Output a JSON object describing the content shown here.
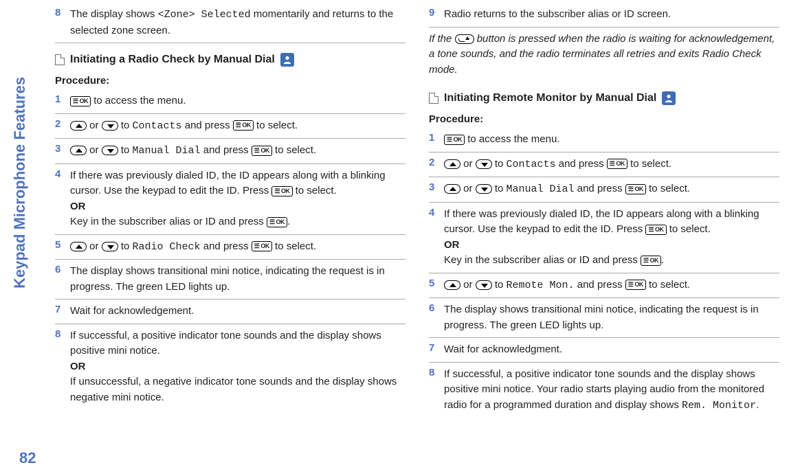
{
  "sidebar": {
    "label": "Keypad Microphone Features",
    "page": "82"
  },
  "col1": {
    "topStep": {
      "num": "8",
      "pre": "The display shows ",
      "code": "<Zone> Selected",
      "post": " momentarily and returns to the selected zone screen."
    },
    "sect": {
      "title": "Initiating a Radio Check by Manual Dial",
      "proc": "Procedure:"
    },
    "steps": {
      "s1": {
        "num": "1",
        "t1": " to access the menu."
      },
      "s2": {
        "num": "2",
        "or": " or ",
        "to": " to ",
        "code": "Contacts",
        "andpress": " and press ",
        "sel": " to select."
      },
      "s3": {
        "num": "3",
        "or": " or ",
        "to": " to ",
        "code": "Manual Dial",
        "andpress": " and press ",
        "sel": " to select."
      },
      "s4": {
        "num": "4",
        "t1": "If there was previously dialed ID, the ID appears along with a blinking cursor. Use the keypad to edit the ID. Press ",
        "t2": " to select.",
        "or": "OR",
        "t3": "Key in the subscriber alias or ID and press ",
        "t4": "."
      },
      "s5": {
        "num": "5",
        "or": " or ",
        "to": " to ",
        "code": "Radio Check",
        "andpress": " and press ",
        "sel": " to select."
      },
      "s6": {
        "num": "6",
        "t": "The display shows transitional mini notice, indicating the request is in progress. The green LED lights up."
      },
      "s7": {
        "num": "7",
        "t": "Wait for acknowledgement."
      },
      "s8": {
        "num": "8",
        "t1": "If successful, a positive indicator tone sounds and the display shows positive mini notice.",
        "or": "OR",
        "t2": "If unsuccessful, a negative indicator tone sounds and the display shows negative mini notice."
      }
    }
  },
  "col2": {
    "topStep": {
      "num": "9",
      "t": "Radio returns to the subscriber alias or ID screen."
    },
    "italic": {
      "p1": "If the ",
      "p2": " button is pressed when the radio is waiting for acknowledgement, a tone sounds, and the radio terminates all retries and exits Radio Check mode."
    },
    "sect": {
      "title": "Initiating Remote Monitor by Manual Dial",
      "proc": "Procedure:"
    },
    "steps": {
      "s1": {
        "num": "1",
        "t1": " to access the menu."
      },
      "s2": {
        "num": "2",
        "or": " or ",
        "to": " to ",
        "code": "Contacts",
        "andpress": " and press ",
        "sel": " to select."
      },
      "s3": {
        "num": "3",
        "or": " or ",
        "to": " to ",
        "code": "Manual Dial",
        "andpress": " and press ",
        "sel": " to select."
      },
      "s4": {
        "num": "4",
        "t1": "If there was previously dialed ID, the ID appears along with a blinking cursor. Use the keypad to edit the ID. Press ",
        "t2": " to select.",
        "or": "OR",
        "t3": "Key in the subscriber alias or ID and press ",
        "t4": "."
      },
      "s5": {
        "num": "5",
        "or": " or ",
        "to": " to ",
        "code": "Remote Mon.",
        "andpress": " and press ",
        "sel": " to select."
      },
      "s6": {
        "num": "6",
        "t": "The display shows transitional mini notice, indicating the request is in progress. The green LED lights up."
      },
      "s7": {
        "num": "7",
        "t": "Wait for acknowledgment."
      },
      "s8": {
        "num": "8",
        "t1": "If successful, a positive indicator tone sounds and the display shows positive mini notice. Your radio starts playing audio from the monitored radio for a programmed duration and display shows ",
        "code": "Rem. Monitor",
        "t2": "."
      }
    }
  }
}
